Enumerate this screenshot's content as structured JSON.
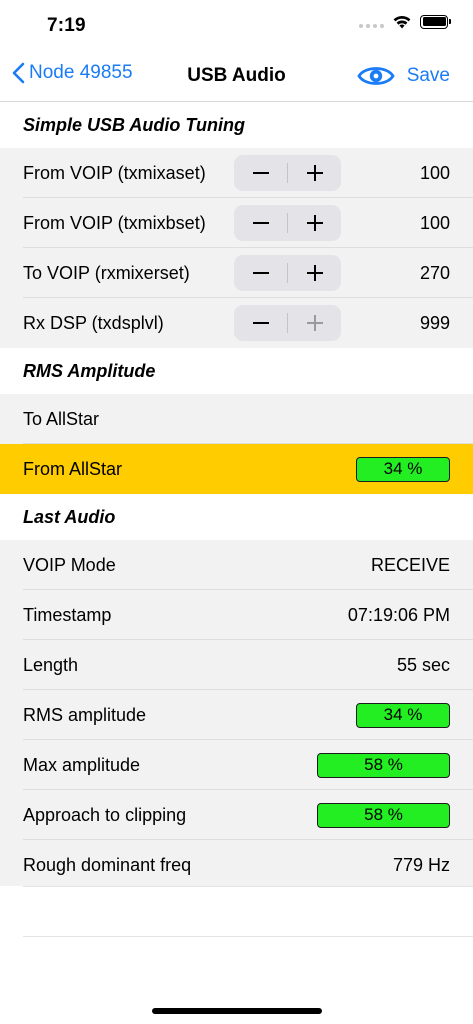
{
  "status": {
    "time": "7:19"
  },
  "nav": {
    "back_label": "Node 49855",
    "title": "USB Audio",
    "save_label": "Save"
  },
  "sections": {
    "tuning": {
      "header": "Simple USB Audio Tuning",
      "rows": [
        {
          "label": "From VOIP (txmixaset)",
          "value": "100"
        },
        {
          "label": "From VOIP (txmixbset)",
          "value": "100"
        },
        {
          "label": "To VOIP (rxmixerset)",
          "value": "270"
        },
        {
          "label": "Rx DSP (txdsplvl)",
          "value": "999"
        }
      ]
    },
    "rms": {
      "header": "RMS Amplitude",
      "to_allstar_label": "To AllStar",
      "from_allstar_label": "From AllStar",
      "from_allstar_value": "34 %",
      "from_allstar_level": 0.34
    },
    "last_audio": {
      "header": "Last Audio",
      "voip_mode_label": "VOIP Mode",
      "voip_mode_value": "RECEIVE",
      "timestamp_label": "Timestamp",
      "timestamp_value": "07:19:06 PM",
      "length_label": "Length",
      "length_value": "55 sec",
      "rms_label": "RMS amplitude",
      "rms_value": "34 %",
      "rms_level": 0.34,
      "max_label": "Max amplitude",
      "max_value": "58 %",
      "max_level": 0.58,
      "clipping_label": "Approach to clipping",
      "clipping_value": "58 %",
      "clipping_level": 0.58,
      "freq_label": "Rough dominant freq",
      "freq_value": "779 Hz"
    }
  },
  "colors": {
    "accent": "#1a7cf5",
    "highlight": "#ffcc00",
    "meter": "#22ee22"
  }
}
